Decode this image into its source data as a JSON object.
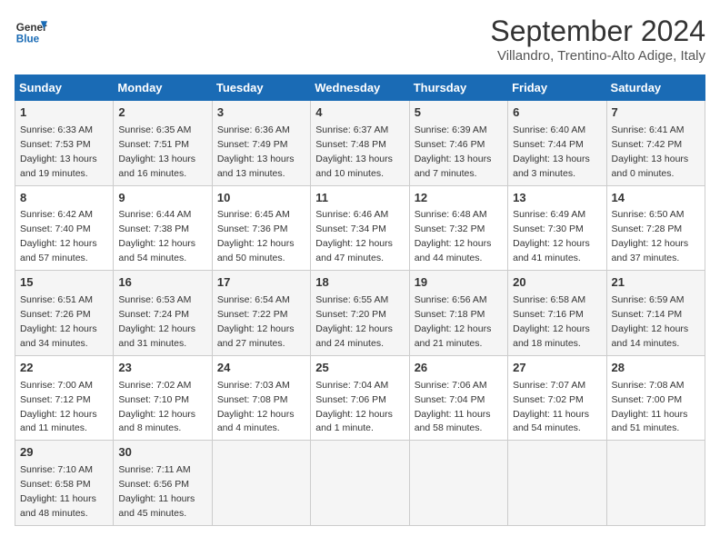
{
  "header": {
    "logo_line1": "General",
    "logo_line2": "Blue",
    "month_title": "September 2024",
    "subtitle": "Villandro, Trentino-Alto Adige, Italy"
  },
  "weekdays": [
    "Sunday",
    "Monday",
    "Tuesday",
    "Wednesday",
    "Thursday",
    "Friday",
    "Saturday"
  ],
  "weeks": [
    [
      {
        "day": "1",
        "rise": "6:33 AM",
        "set": "7:53 PM",
        "daylight": "13 hours and 19 minutes."
      },
      {
        "day": "2",
        "rise": "6:35 AM",
        "set": "7:51 PM",
        "daylight": "13 hours and 16 minutes."
      },
      {
        "day": "3",
        "rise": "6:36 AM",
        "set": "7:49 PM",
        "daylight": "13 hours and 13 minutes."
      },
      {
        "day": "4",
        "rise": "6:37 AM",
        "set": "7:48 PM",
        "daylight": "13 hours and 10 minutes."
      },
      {
        "day": "5",
        "rise": "6:39 AM",
        "set": "7:46 PM",
        "daylight": "13 hours and 7 minutes."
      },
      {
        "day": "6",
        "rise": "6:40 AM",
        "set": "7:44 PM",
        "daylight": "13 hours and 3 minutes."
      },
      {
        "day": "7",
        "rise": "6:41 AM",
        "set": "7:42 PM",
        "daylight": "13 hours and 0 minutes."
      }
    ],
    [
      {
        "day": "8",
        "rise": "6:42 AM",
        "set": "7:40 PM",
        "daylight": "12 hours and 57 minutes."
      },
      {
        "day": "9",
        "rise": "6:44 AM",
        "set": "7:38 PM",
        "daylight": "12 hours and 54 minutes."
      },
      {
        "day": "10",
        "rise": "6:45 AM",
        "set": "7:36 PM",
        "daylight": "12 hours and 50 minutes."
      },
      {
        "day": "11",
        "rise": "6:46 AM",
        "set": "7:34 PM",
        "daylight": "12 hours and 47 minutes."
      },
      {
        "day": "12",
        "rise": "6:48 AM",
        "set": "7:32 PM",
        "daylight": "12 hours and 44 minutes."
      },
      {
        "day": "13",
        "rise": "6:49 AM",
        "set": "7:30 PM",
        "daylight": "12 hours and 41 minutes."
      },
      {
        "day": "14",
        "rise": "6:50 AM",
        "set": "7:28 PM",
        "daylight": "12 hours and 37 minutes."
      }
    ],
    [
      {
        "day": "15",
        "rise": "6:51 AM",
        "set": "7:26 PM",
        "daylight": "12 hours and 34 minutes."
      },
      {
        "day": "16",
        "rise": "6:53 AM",
        "set": "7:24 PM",
        "daylight": "12 hours and 31 minutes."
      },
      {
        "day": "17",
        "rise": "6:54 AM",
        "set": "7:22 PM",
        "daylight": "12 hours and 27 minutes."
      },
      {
        "day": "18",
        "rise": "6:55 AM",
        "set": "7:20 PM",
        "daylight": "12 hours and 24 minutes."
      },
      {
        "day": "19",
        "rise": "6:56 AM",
        "set": "7:18 PM",
        "daylight": "12 hours and 21 minutes."
      },
      {
        "day": "20",
        "rise": "6:58 AM",
        "set": "7:16 PM",
        "daylight": "12 hours and 18 minutes."
      },
      {
        "day": "21",
        "rise": "6:59 AM",
        "set": "7:14 PM",
        "daylight": "12 hours and 14 minutes."
      }
    ],
    [
      {
        "day": "22",
        "rise": "7:00 AM",
        "set": "7:12 PM",
        "daylight": "12 hours and 11 minutes."
      },
      {
        "day": "23",
        "rise": "7:02 AM",
        "set": "7:10 PM",
        "daylight": "12 hours and 8 minutes."
      },
      {
        "day": "24",
        "rise": "7:03 AM",
        "set": "7:08 PM",
        "daylight": "12 hours and 4 minutes."
      },
      {
        "day": "25",
        "rise": "7:04 AM",
        "set": "7:06 PM",
        "daylight": "12 hours and 1 minute."
      },
      {
        "day": "26",
        "rise": "7:06 AM",
        "set": "7:04 PM",
        "daylight": "11 hours and 58 minutes."
      },
      {
        "day": "27",
        "rise": "7:07 AM",
        "set": "7:02 PM",
        "daylight": "11 hours and 54 minutes."
      },
      {
        "day": "28",
        "rise": "7:08 AM",
        "set": "7:00 PM",
        "daylight": "11 hours and 51 minutes."
      }
    ],
    [
      {
        "day": "29",
        "rise": "7:10 AM",
        "set": "6:58 PM",
        "daylight": "11 hours and 48 minutes."
      },
      {
        "day": "30",
        "rise": "7:11 AM",
        "set": "6:56 PM",
        "daylight": "11 hours and 45 minutes."
      },
      null,
      null,
      null,
      null,
      null
    ]
  ],
  "colors": {
    "header_bg": "#1a6bb5",
    "odd_row": "#f5f5f5",
    "even_row": "#ffffff"
  }
}
